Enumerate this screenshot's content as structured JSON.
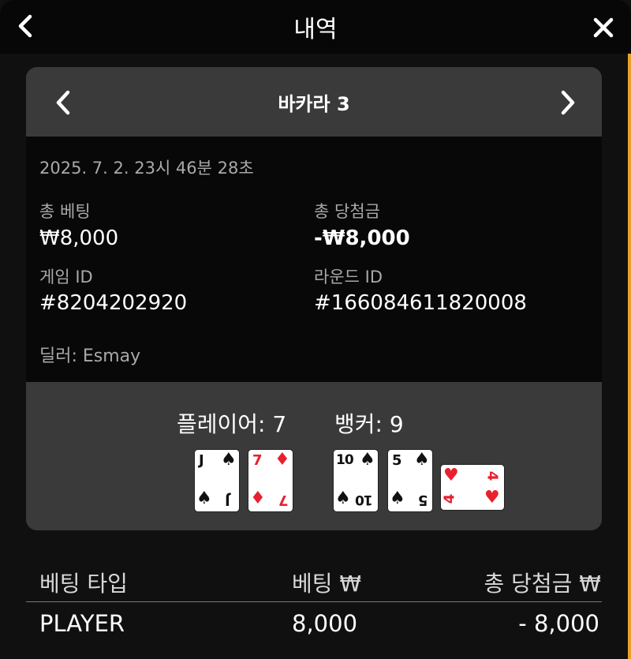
{
  "header": {
    "title": "내역"
  },
  "round": {
    "title": "바카라 3",
    "datetime": "2025. 7. 2. 23시 46분 28초",
    "total_bet_label": "총 베팅",
    "total_bet_value": "₩8,000",
    "total_win_label": "총 당첨금",
    "total_win_value": "-₩8,000",
    "game_id_label": "게임 ID",
    "game_id_value": "#8204202920",
    "round_id_label": "라운드 ID",
    "round_id_value": "#166084611820008",
    "dealer": "딜러: Esmay"
  },
  "result": {
    "player_score": "플레이어: 7",
    "banker_score": "뱅커: 9",
    "player_cards": [
      {
        "rank": "J",
        "suit": "♠"
      },
      {
        "rank": "7",
        "suit": "♦"
      }
    ],
    "banker_cards": [
      {
        "rank": "10",
        "suit": "♠"
      },
      {
        "rank": "5",
        "suit": "♠"
      },
      {
        "rank": "4",
        "suit": "♥"
      }
    ]
  },
  "bets_table": {
    "headers": [
      "베팅 타입",
      "베팅 ₩",
      "총 당첨금 ₩"
    ],
    "rows": [
      {
        "type": "PLAYER",
        "bet": "8,000",
        "win": "- 8,000"
      }
    ]
  },
  "colors": {
    "accent": "#e8a12b",
    "red_suit": "#e8202e"
  }
}
